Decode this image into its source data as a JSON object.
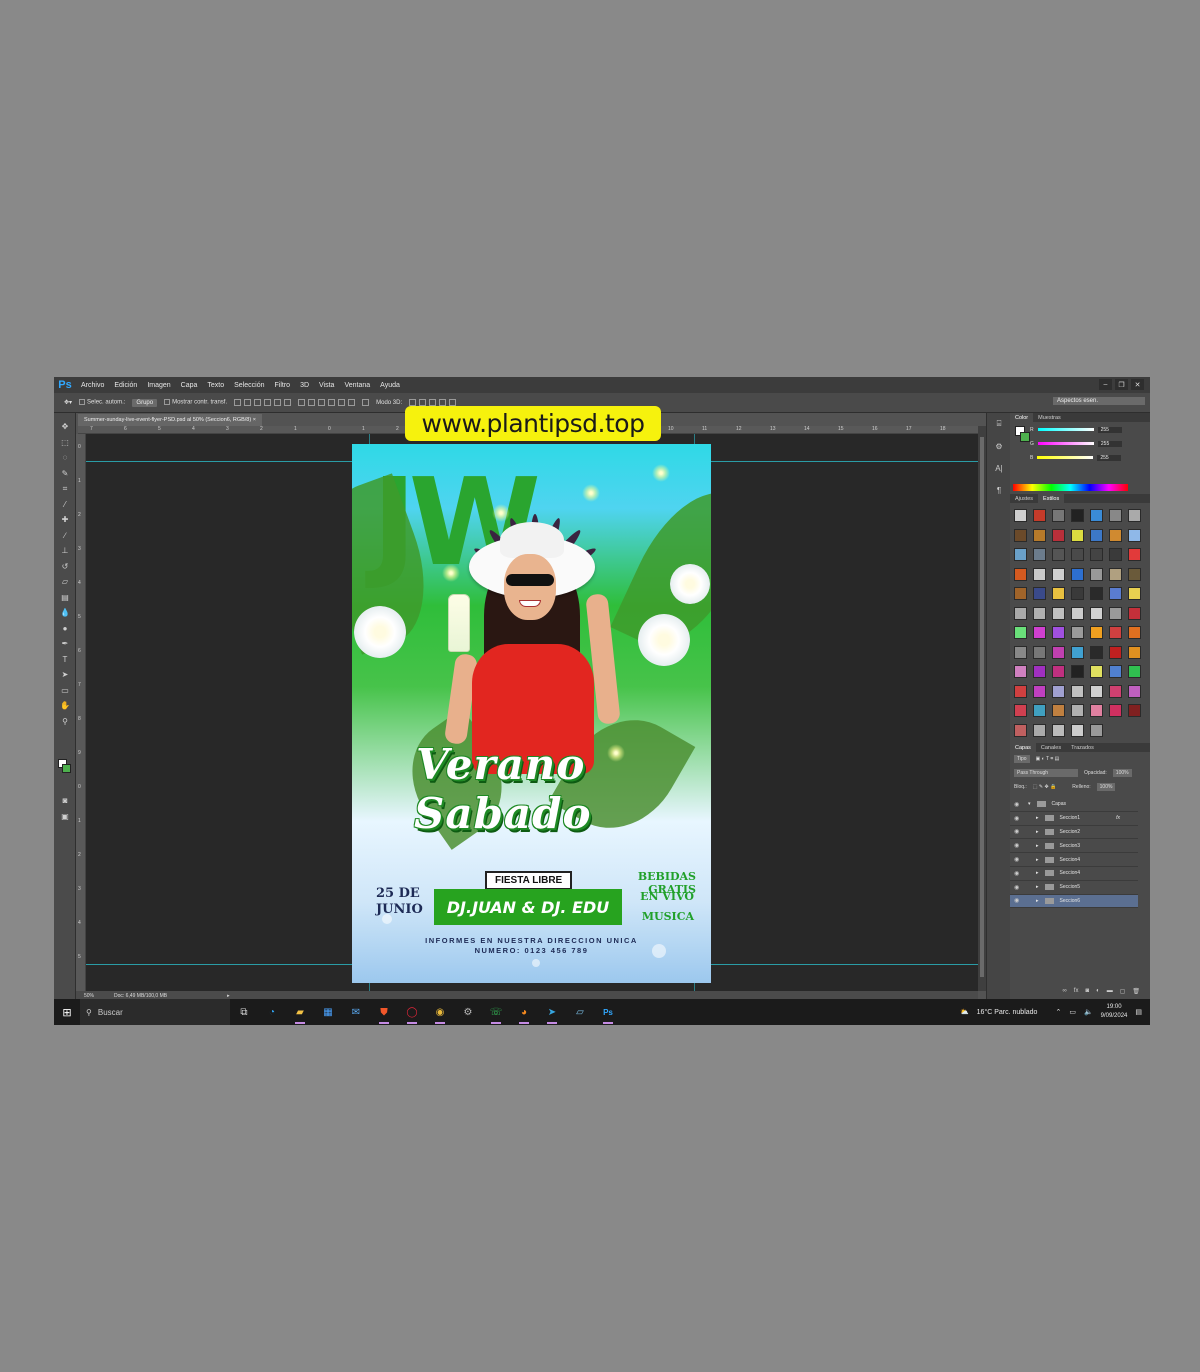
{
  "app": {
    "logo": "Ps",
    "menu": [
      "Archivo",
      "Edición",
      "Imagen",
      "Capa",
      "Texto",
      "Selección",
      "Filtro",
      "3D",
      "Vista",
      "Ventana",
      "Ayuda"
    ],
    "window_controls": [
      "–",
      "❐",
      "✕"
    ]
  },
  "options": {
    "auto_select_label": "Selec. autom.:",
    "group_value": "Grupo",
    "transform_label": "Mostrar contr. transf.",
    "mode_label": "Modo 3D:",
    "workspace": "Aspectos esen."
  },
  "document": {
    "tab_title": "Summer-sunday-live-event-flyer-PSD.psd al 50% (Seccion6, RGB/8) ×",
    "zoom": "50%",
    "doc_size": "Doc: 6,49 MB/100,0 MB",
    "ruler_top": [
      "7",
      "6",
      "5",
      "4",
      "3",
      "2",
      "1",
      "0",
      "1",
      "2",
      "3",
      "4",
      "5",
      "6",
      "7",
      "8",
      "9",
      "10",
      "11",
      "12",
      "13",
      "14",
      "15",
      "16",
      "17",
      "18"
    ],
    "ruler_left": [
      "0",
      "1",
      "2",
      "3",
      "4",
      "5",
      "6",
      "7",
      "8",
      "9",
      "0",
      "1",
      "2",
      "3",
      "4",
      "5"
    ]
  },
  "watermark": "www.plantipsd.top",
  "flyer": {
    "title1": "Verano",
    "title2": "Sabado",
    "date_line1": "25 DE",
    "date_line2": "JUNIO",
    "fiesta": "FIESTA LIBRE",
    "djs": "DJ.JUAN & DJ. EDU",
    "right1": "BEBIDAS GRATIS",
    "right2": "EN VIVO",
    "right3": "MUSICA",
    "info1": "INFORMES EN NUESTRA DIRECCION UNICA",
    "info2": "NUMERO: 0123 456 789"
  },
  "color_panel": {
    "tabs": [
      "Color",
      "Muestras"
    ],
    "r": "255",
    "g": "255",
    "b": "255",
    "r_label": "R",
    "g_label": "G",
    "b_label": "B"
  },
  "styles_panel": {
    "tabs": [
      "Ajustes",
      "Estilos"
    ]
  },
  "layers_panel": {
    "tabs": [
      "Capas",
      "Canales",
      "Trazados"
    ],
    "filter": "Tipo",
    "blend": "Pass Through",
    "opacity_label": "Opacidad:",
    "opacity": "100%",
    "lock_label": "Bloq.:",
    "fill_label": "Relleno:",
    "fill": "100%",
    "group": "Capas",
    "layers": [
      "Seccion1",
      "Seccion2",
      "Seccion3",
      "Seccion4",
      "Seccion4",
      "Seccion5",
      "Seccion6"
    ]
  },
  "taskbar": {
    "search_placeholder": "Buscar",
    "weather": "16°C  Parc. nublado",
    "time": "19:00",
    "date": "9/09/2024"
  },
  "colors": {
    "accent": "#31a8ff",
    "flyer_green": "#27a31f",
    "watermark_bg": "#f6f20d"
  }
}
